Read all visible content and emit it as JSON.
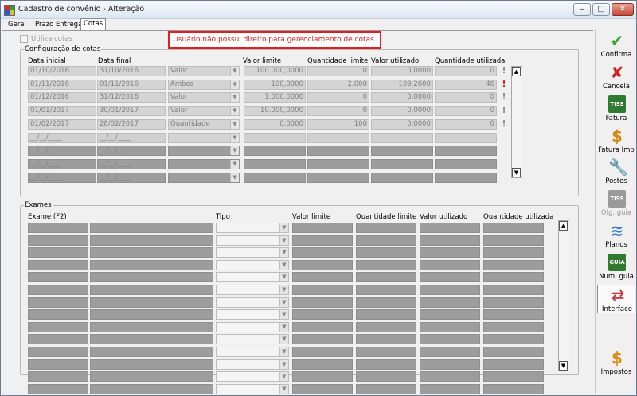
{
  "window": {
    "title": "Cadastro de convênio - Alteração",
    "minimize": "‒",
    "maximize": "▢",
    "close": "✕"
  },
  "tabs": [
    {
      "label": "Geral"
    },
    {
      "label": "Prazo Entrega"
    },
    {
      "label": "Cotas"
    }
  ],
  "error_message": "Usuário não possui direito para gerenciamento de cotas.",
  "utiliza_cotas_label": "Utiliza cotas",
  "config": {
    "legend": "Configuração de cotas",
    "headers": [
      "Data inicial",
      "Data final",
      "",
      "Valor limite",
      "Quantidade limite",
      "Valor utilizado",
      "Quantidade utilizada"
    ],
    "rows": [
      {
        "start": "01/10/2016",
        "end": "31/10/2016",
        "type": "Valor",
        "valor_limite": "100.000,0000",
        "qtd_limite": "0",
        "valor_util": "0,0000",
        "qtd_util": "0",
        "warn": "!",
        "warn_color": "#8c8c8c"
      },
      {
        "start": "01/11/2016",
        "end": "01/11/2016",
        "type": "Ambos",
        "valor_limite": "100,0000",
        "qtd_limite": "2.000",
        "valor_util": "109,2600",
        "qtd_util": "46",
        "warn": "!",
        "warn_color": "#e01010"
      },
      {
        "start": "01/12/2016",
        "end": "31/12/2016",
        "type": "Valor",
        "valor_limite": "1.000,0000",
        "qtd_limite": "0",
        "valor_util": "0,0000",
        "qtd_util": "0",
        "warn": "!",
        "warn_color": "#8c8c8c"
      },
      {
        "start": "01/01/2017",
        "end": "30/01/2017",
        "type": "Valor",
        "valor_limite": "10.000,0000",
        "qtd_limite": "0",
        "valor_util": "0,0000",
        "qtd_util": "0",
        "warn": "!",
        "warn_color": "#8c8c8c"
      },
      {
        "start": "01/02/2017",
        "end": "28/02/2017",
        "type": "Quantidade",
        "valor_limite": "0,0000",
        "qtd_limite": "100",
        "valor_util": "0,0000",
        "qtd_util": "0",
        "warn": "!",
        "warn_color": "#8c8c8c"
      },
      {
        "start": "__/__/____",
        "end": "__/__/____",
        "type": "",
        "valor_limite": "",
        "qtd_limite": "",
        "valor_util": "",
        "qtd_util": "",
        "warn": "",
        "warn_color": ""
      },
      {
        "start": "__/__/____",
        "end": "__/__/____",
        "type": "",
        "valor_limite": "",
        "qtd_limite": "",
        "valor_util": "",
        "qtd_util": "",
        "warn": "",
        "warn_color": ""
      },
      {
        "start": "__/__/____",
        "end": "__/__/____",
        "type": "",
        "valor_limite": "",
        "qtd_limite": "",
        "valor_util": "",
        "qtd_util": "",
        "warn": "",
        "warn_color": ""
      },
      {
        "start": "__/__/____",
        "end": "__/__/____",
        "type": "",
        "valor_limite": "",
        "qtd_limite": "",
        "valor_util": "",
        "qtd_util": "",
        "warn": "",
        "warn_color": ""
      }
    ]
  },
  "exames": {
    "legend": "Exames",
    "headers": [
      "Exame (F2)",
      "",
      "Tipo",
      "Valor limite",
      "Quantidade limite",
      "Valor utilizado",
      "Quantidade utilizada"
    ],
    "row_count": 14
  },
  "toolbar": [
    {
      "label": "Confirma",
      "icon": "check-icon",
      "glyph": "✔",
      "color": "#3aa63a",
      "enabled": true
    },
    {
      "label": "Cancela",
      "icon": "x-icon",
      "glyph": "✘",
      "color": "#d42020",
      "enabled": true
    },
    {
      "label": "Fatura",
      "icon": "tiss-icon",
      "glyph": "TISS",
      "color": "#2e7a2e",
      "enabled": true
    },
    {
      "label": "Fatura Imp",
      "icon": "dollar-doc-icon",
      "glyph": "$",
      "color": "#d08a10",
      "enabled": true
    },
    {
      "label": "Postos",
      "icon": "wrench-icon",
      "glyph": "🔧",
      "color": "#8a3aa6",
      "enabled": true
    },
    {
      "label": "Olg. guia",
      "icon": "tiss-guide-icon",
      "glyph": "TISS",
      "color": "#9a9a9a",
      "enabled": false
    },
    {
      "label": "Planos",
      "icon": "layers-icon",
      "glyph": "≋",
      "color": "#3a7ac8",
      "enabled": true
    },
    {
      "label": "Num. guia",
      "icon": "guia-icon",
      "glyph": "GUIA",
      "color": "#2e7a2e",
      "enabled": true
    },
    {
      "label": "Interface",
      "icon": "interface-icon",
      "glyph": "⇄",
      "color": "#c84040",
      "enabled": true
    },
    {
      "label": "Impostos",
      "icon": "dollar-icon",
      "glyph": "$",
      "color": "#e08a10",
      "enabled": true
    }
  ]
}
